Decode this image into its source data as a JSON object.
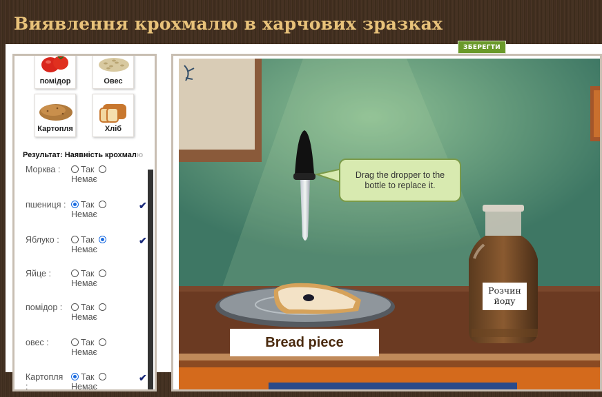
{
  "title": "Виявлення крохмалю в харчових зразках",
  "save_label": "ЗБЕРЕГТИ",
  "foods": [
    {
      "label": "помідор",
      "icon": "tomato-icon"
    },
    {
      "label": "Овес",
      "icon": "oats-icon"
    },
    {
      "label": "Картопля",
      "icon": "potato-icon"
    },
    {
      "label": "Хліб",
      "icon": "bread-icon"
    }
  ],
  "result": {
    "heading": "Результат: Наявність крохмал",
    "heading_cut": "ю",
    "yes_label": "Так",
    "no_label": "Немає",
    "rows": [
      {
        "name": "Морква :",
        "selected": "none",
        "checked": false
      },
      {
        "name": "пшениця :",
        "selected": "yes",
        "checked": true
      },
      {
        "name": "Яблуко :",
        "selected": "no",
        "checked": true
      },
      {
        "name": "Яйце :",
        "selected": "none",
        "checked": false
      },
      {
        "name": "помідор :",
        "selected": "none",
        "checked": false
      },
      {
        "name": "овес :",
        "selected": "none",
        "checked": false
      },
      {
        "name": "Картопля :",
        "selected": "yes",
        "checked": true
      }
    ],
    "check_mark": "✔"
  },
  "scene": {
    "tooltip": "Drag the dropper to the bottle to replace it.",
    "plate_label": "Bread piece",
    "bottle_label": "Розчин йоду"
  },
  "colors": {
    "title": "#e8c27a",
    "save_bg": "#6a9a2a",
    "radio_on": "#1a6be0",
    "wall": "#3f7a66",
    "table": "#6b3a22"
  }
}
